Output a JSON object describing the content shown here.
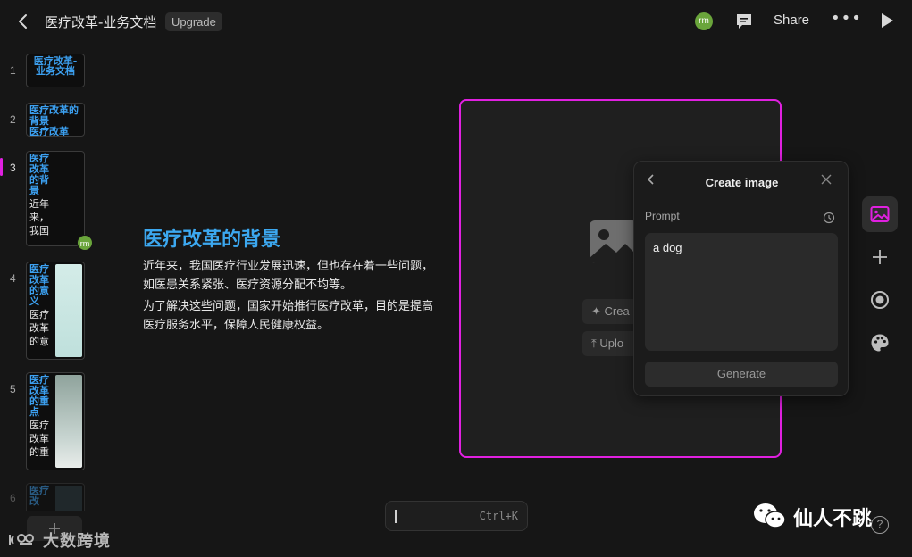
{
  "header": {
    "back_icon": "chevron-left-icon",
    "title": "医疗改革-业务文档",
    "badge": "Upgrade",
    "avatar": "rm",
    "share_label": "Share",
    "more_label": "•••"
  },
  "slides": [
    {
      "number": "1",
      "title": "医疗改革-业务文档"
    },
    {
      "number": "2",
      "title": "医疗改革的背景",
      "title_line2": "医疗改革"
    },
    {
      "number": "3",
      "title": "医疗改革的背景",
      "body": "近年来，我国"
    },
    {
      "number": "4",
      "title": "医疗改革的意义",
      "body": "医疗改革的意"
    },
    {
      "number": "5",
      "title": "医疗改革的重点",
      "body": "医疗改革的重"
    },
    {
      "number": "6",
      "title": "医疗改"
    }
  ],
  "active_slide": "3",
  "slide_avatar": "rm",
  "slide": {
    "heading": "医疗改革的背景",
    "paragraphs": [
      "近年来，我国医疗行业发展迅速，但也存在着一些问题，如医患关系紧张、医疗资源分配不均等。",
      "为了解决这些问题，国家开始推行医疗改革，目的是提高医疗服务水平，保障人民健康权益。"
    ]
  },
  "image_placeholder": {
    "create_label": "Crea",
    "upload_label": "Uplo",
    "accent": "#e020e0"
  },
  "create_image_panel": {
    "title": "Create image",
    "prompt_label": "Prompt",
    "prompt_value": "a dog",
    "generate_label": "Generate"
  },
  "tools": [
    "image-icon",
    "plus-icon",
    "record-icon",
    "palette-icon"
  ],
  "command_bar": {
    "shortcut": "Ctrl+K"
  },
  "help_label": "?",
  "watermarks": {
    "left": "大数跨境",
    "right": "仙人不跳"
  }
}
